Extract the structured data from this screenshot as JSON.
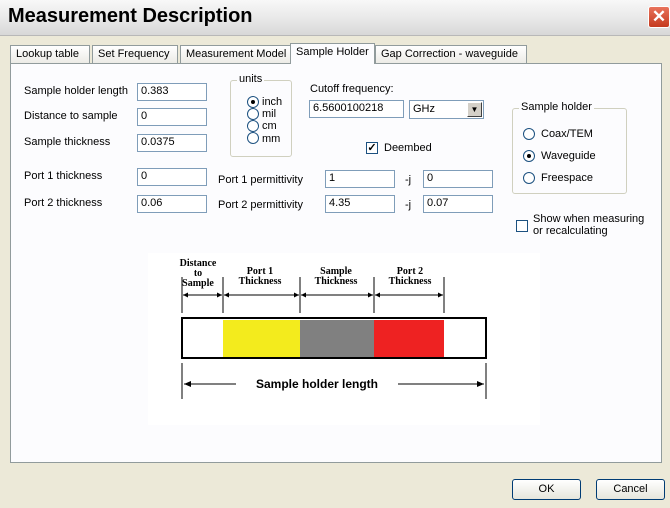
{
  "window": {
    "title": "Measurement Description",
    "close_glyph": "✕"
  },
  "tabs": [
    {
      "label": "Lookup table"
    },
    {
      "label": "Set Frequency"
    },
    {
      "label": "Measurement Model"
    },
    {
      "label": "Sample Holder",
      "active": true
    },
    {
      "label": "Gap Correction - waveguide"
    }
  ],
  "fields": {
    "sample_holder_length": {
      "label": "Sample holder length",
      "value": "0.383"
    },
    "distance_to_sample": {
      "label": "Distance to sample",
      "value": "0"
    },
    "sample_thickness": {
      "label": "Sample thickness",
      "value": "0.0375"
    },
    "port1_thickness": {
      "label": "Port 1 thickness",
      "value": "0"
    },
    "port2_thickness": {
      "label": "Port 2 thickness",
      "value": "0.06"
    }
  },
  "units": {
    "title": "units",
    "options": [
      {
        "label": "inch",
        "selected": true
      },
      {
        "label": "mil",
        "selected": false
      },
      {
        "label": "cm",
        "selected": false
      },
      {
        "label": "mm",
        "selected": false
      }
    ]
  },
  "cutoff": {
    "label": "Cutoff frequency:",
    "value": "6.5600100218",
    "unit": "GHz"
  },
  "deembed": {
    "label": "Deembed",
    "checked": true
  },
  "permittivity": {
    "port1": {
      "label": "Port 1 permittivity",
      "real": "1",
      "sep": "-j",
      "imag": "0"
    },
    "port2": {
      "label": "Port 2 permittivity",
      "real": "4.35",
      "sep": "-j",
      "imag": "0.07"
    }
  },
  "sample_holder": {
    "title": "Sample holder",
    "options": [
      {
        "label": "Coax/TEM",
        "selected": false
      },
      {
        "label": "Waveguide",
        "selected": true
      },
      {
        "label": "Freespace",
        "selected": false
      }
    ]
  },
  "show_when": {
    "label1": "Show when measuring",
    "label2": "or recalculating",
    "checked": false
  },
  "diagram": {
    "distance": [
      "Distance",
      "to",
      "Sample"
    ],
    "port1": [
      "Port 1",
      "Thickness"
    ],
    "sample": [
      "Sample",
      "Thickness"
    ],
    "port2": [
      "Port 2",
      "Thickness"
    ],
    "length_label": "Sample holder length",
    "colors": {
      "port1": "#f3eb1d",
      "sample": "#808080",
      "port2": "#ee2222"
    }
  },
  "buttons": {
    "ok": "OK",
    "cancel": "Cancel"
  }
}
